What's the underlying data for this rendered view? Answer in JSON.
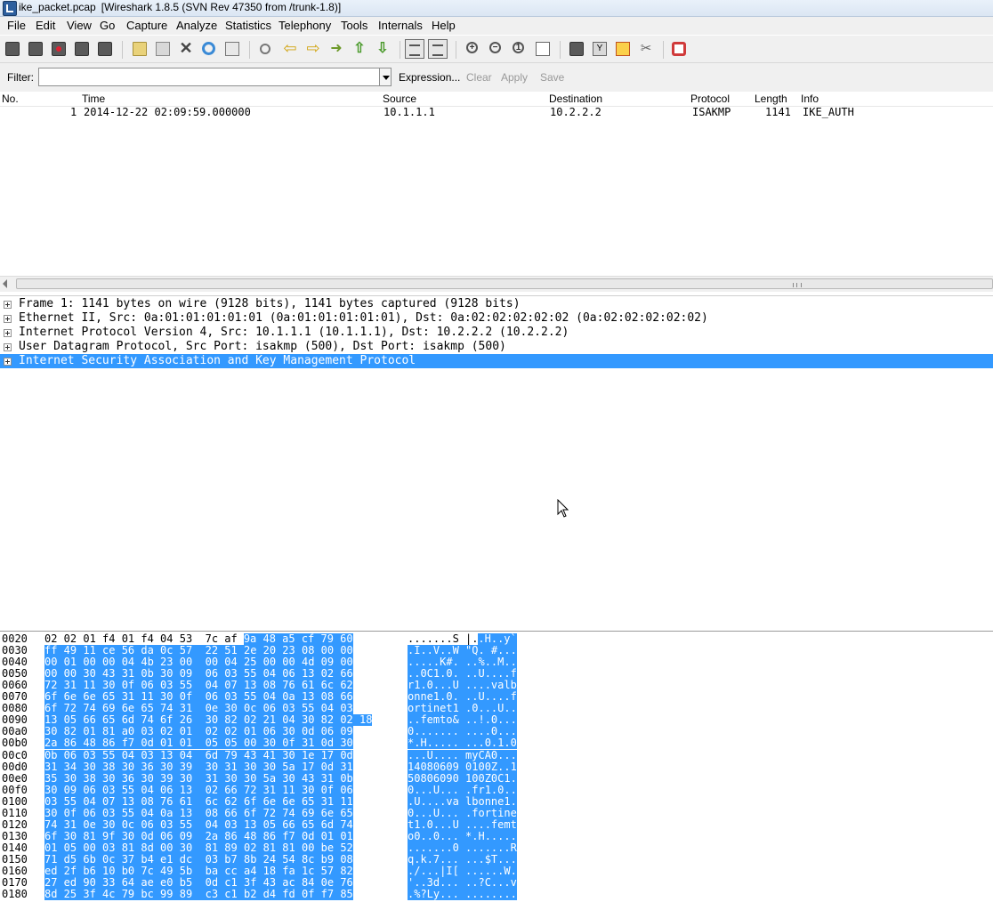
{
  "window": {
    "title_file": "ike_packet.pcap",
    "title_app": "[Wireshark 1.8.5  (SVN Rev 47350 from /trunk-1.8)]"
  },
  "menu": [
    "File",
    "Edit",
    "View",
    "Go",
    "Capture",
    "Analyze",
    "Statistics",
    "Telephony",
    "Tools",
    "Internals",
    "Help"
  ],
  "toolbar": {
    "icons": [
      "interfaces-icon",
      "options-icon",
      "start-capture-icon",
      "stop-capture-icon",
      "restart-capture-icon",
      "open-file-icon",
      "save-file-icon",
      "close-file-icon",
      "reload-icon",
      "print-icon",
      "find-packet-icon",
      "go-back-icon",
      "go-forward-icon",
      "go-to-packet-icon",
      "first-packet-icon",
      "last-packet-icon",
      "colorize-icon",
      "auto-scroll-icon",
      "zoom-in-icon",
      "zoom-out-icon",
      "normal-size-icon",
      "resize-columns-icon",
      "capture-filters-icon",
      "display-filters-icon",
      "coloring-rules-icon",
      "preferences-icon",
      "help-icon"
    ]
  },
  "filter": {
    "label": "Filter:",
    "value": "",
    "expression": "Expression...",
    "clear": "Clear",
    "apply": "Apply",
    "save": "Save"
  },
  "packet_list": {
    "columns": [
      "No.",
      "Time",
      "Source",
      "Destination",
      "Protocol",
      "Length",
      "Info"
    ],
    "rows": [
      {
        "no": "1",
        "time": "2014-12-22 02:09:59.000000",
        "source": "10.1.1.1",
        "destination": "10.2.2.2",
        "protocol": "ISAKMP",
        "length": "1141",
        "info": "IKE_AUTH"
      }
    ]
  },
  "details": [
    {
      "text": "Frame 1: 1141 bytes on wire (9128 bits), 1141 bytes captured (9128 bits)",
      "selected": false
    },
    {
      "text": "Ethernet II, Src: 0a:01:01:01:01:01 (0a:01:01:01:01:01), Dst: 0a:02:02:02:02:02 (0a:02:02:02:02:02)",
      "selected": false
    },
    {
      "text": "Internet Protocol Version 4, Src: 10.1.1.1 (10.1.1.1), Dst: 10.2.2.2 (10.2.2.2)",
      "selected": false
    },
    {
      "text": "User Datagram Protocol, Src Port: isakmp (500), Dst Port: isakmp (500)",
      "selected": false
    },
    {
      "text": "Internet Security Association and Key Management Protocol",
      "selected": true
    }
  ],
  "hex": [
    {
      "off": "0020",
      "pre": "02 02 01 f4 01 f4 04 53  7c af ",
      "hl": "9a 48 a5 cf 79 60",
      "apre": ".......S |.",
      "ahl": ".H..y`"
    },
    {
      "off": "0030",
      "pre": "",
      "hl": "ff 49 11 ce 56 da 0c 57  22 51 2e 20 23 08 00 00",
      "apre": "",
      "ahl": ".I..V..W \"Q. #..."
    },
    {
      "off": "0040",
      "pre": "",
      "hl": "00 01 00 00 04 4b 23 00  00 04 25 00 00 4d 09 00",
      "apre": "",
      "ahl": ".....K#. ..%..M.."
    },
    {
      "off": "0050",
      "pre": "",
      "hl": "00 00 30 43 31 0b 30 09  06 03 55 04 06 13 02 66",
      "apre": "",
      "ahl": "..0C1.0. ..U....f"
    },
    {
      "off": "0060",
      "pre": "",
      "hl": "72 31 11 30 0f 06 03 55  04 07 13 08 76 61 6c 62",
      "apre": "",
      "ahl": "r1.0...U ....valb"
    },
    {
      "off": "0070",
      "pre": "",
      "hl": "6f 6e 6e 65 31 11 30 0f  06 03 55 04 0a 13 08 66",
      "apre": "",
      "ahl": "onne1.0. ..U....f"
    },
    {
      "off": "0080",
      "pre": "",
      "hl": "6f 72 74 69 6e 65 74 31  0e 30 0c 06 03 55 04 03",
      "apre": "",
      "ahl": "ortinet1 .0...U.."
    },
    {
      "off": "0090",
      "pre": "",
      "hl": "13 05 66 65 6d 74 6f 26  30 82 02 21 04 30 82 02 18",
      "apre": "",
      "ahl": "..femto& ..!.0..."
    },
    {
      "off": "00a0",
      "pre": "",
      "hl": "30 82 01 81 a0 03 02 01  02 02 01 06 30 0d 06 09",
      "apre": "",
      "ahl": "0....... ....0..."
    },
    {
      "off": "00b0",
      "pre": "",
      "hl": "2a 86 48 86 f7 0d 01 01  05 05 00 30 0f 31 0d 30",
      "apre": "",
      "ahl": "*.H..... ...0.1.0"
    },
    {
      "off": "00c0",
      "pre": "",
      "hl": "0b 06 03 55 04 03 13 04  6d 79 43 41 30 1e 17 0d",
      "apre": "",
      "ahl": "...U.... myCA0..."
    },
    {
      "off": "00d0",
      "pre": "",
      "hl": "31 34 30 38 30 36 30 39  30 31 30 30 5a 17 0d 31",
      "apre": "",
      "ahl": "14080609 0100Z..1"
    },
    {
      "off": "00e0",
      "pre": "",
      "hl": "35 30 38 30 36 30 39 30  31 30 30 5a 30 43 31 0b",
      "apre": "",
      "ahl": "50806090 100Z0C1."
    },
    {
      "off": "00f0",
      "pre": "",
      "hl": "30 09 06 03 55 04 06 13  02 66 72 31 11 30 0f 06",
      "apre": "",
      "ahl": "0...U... .fr1.0.."
    },
    {
      "off": "0100",
      "pre": "",
      "hl": "03 55 04 07 13 08 76 61  6c 62 6f 6e 6e 65 31 11",
      "apre": "",
      "ahl": ".U....va lbonne1."
    },
    {
      "off": "0110",
      "pre": "",
      "hl": "30 0f 06 03 55 04 0a 13  08 66 6f 72 74 69 6e 65",
      "apre": "",
      "ahl": "0...U... .fortine"
    },
    {
      "off": "0120",
      "pre": "",
      "hl": "74 31 0e 30 0c 06 03 55  04 03 13 05 66 65 6d 74",
      "apre": "",
      "ahl": "t1.0...U ....femt"
    },
    {
      "off": "0130",
      "pre": "",
      "hl": "6f 30 81 9f 30 0d 06 09  2a 86 48 86 f7 0d 01 01",
      "apre": "",
      "ahl": "o0..0... *.H....."
    },
    {
      "off": "0140",
      "pre": "",
      "hl": "01 05 00 03 81 8d 00 30  81 89 02 81 81 00 be 52",
      "apre": "",
      "ahl": ".......0 .......R"
    },
    {
      "off": "0150",
      "pre": "",
      "hl": "71 d5 6b 0c 37 b4 e1 dc  03 b7 8b 24 54 8c b9 08",
      "apre": "",
      "ahl": "q.k.7... ...$T..."
    },
    {
      "off": "0160",
      "pre": "",
      "hl": "ed 2f b6 10 b0 7c 49 5b  ba cc a4 18 fa 1c 57 82",
      "apre": "",
      "ahl": "./...|I[ ......W."
    },
    {
      "off": "0170",
      "pre": "",
      "hl": "27 ed 90 33 64 ae e0 b5  0d c1 3f 43 ac 84 0e 76",
      "apre": "",
      "ahl": "'..3d... ..?C...v"
    },
    {
      "off": "0180",
      "pre": "",
      "hl": "8d 25 3f 4c 79 bc 99 89  c3 c1 b2 d4 fd 0f f7 85",
      "apre": "",
      "ahl": ".%?Ly... ........"
    }
  ],
  "colors": {
    "selection": "#3399ff",
    "chrome": "#f0f0f0"
  }
}
